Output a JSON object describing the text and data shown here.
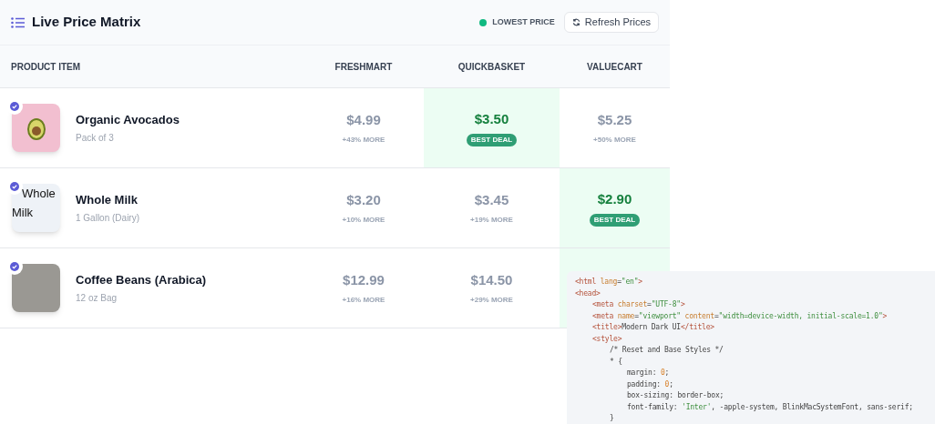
{
  "header": {
    "title": "Live Price Matrix",
    "legend": "LOWEST PRICE",
    "refresh_button": "Refresh Prices"
  },
  "table": {
    "columns": [
      "PRODUCT ITEM",
      "FRESHMART",
      "QUICKBASKET",
      "VALUECART"
    ],
    "rows": [
      {
        "name": "Organic Avocados",
        "detail": "Pack of 3",
        "checked": true,
        "image": {
          "kind": "avocado"
        },
        "prices": [
          {
            "price": "$4.99",
            "note": "+43% MORE",
            "best": false
          },
          {
            "price": "$3.50",
            "badge": "BEST DEAL",
            "best": true
          },
          {
            "price": "$5.25",
            "note": "+50% MORE",
            "best": false
          }
        ]
      },
      {
        "name": "Whole Milk",
        "detail": "1 Gallon (Dairy)",
        "checked": true,
        "image": {
          "kind": "broken",
          "alt": "Whole Milk"
        },
        "prices": [
          {
            "price": "$3.20",
            "note": "+10% MORE",
            "best": false
          },
          {
            "price": "$3.45",
            "note": "+19% MORE",
            "best": false
          },
          {
            "price": "$2.90",
            "badge": "BEST DEAL",
            "best": true
          }
        ]
      },
      {
        "name": "Coffee Beans (Arabica)",
        "detail": "12 oz Bag",
        "checked": true,
        "image": {
          "kind": "photo"
        },
        "prices": [
          {
            "price": "$12.99",
            "note": "+16% MORE",
            "best": false
          },
          {
            "price": "$14.50",
            "note": "+29% MORE",
            "best": false
          },
          {
            "best": true
          }
        ]
      }
    ]
  },
  "code_overlay": {
    "lines": [
      {
        "tokens": [
          {
            "kind": "tag",
            "text": "<html"
          },
          {
            "kind": "attr",
            "text": " lang"
          },
          {
            "kind": "plain",
            "text": "="
          },
          {
            "kind": "string",
            "text": "\"en\""
          },
          {
            "kind": "tag",
            "text": ">"
          }
        ]
      },
      {
        "tokens": [
          {
            "kind": "tag",
            "text": "<head>"
          }
        ],
        "children": [
          {
            "tokens": [
              {
                "kind": "tag",
                "text": "<meta"
              },
              {
                "kind": "attr",
                "text": " charset"
              },
              {
                "kind": "plain",
                "text": "="
              },
              {
                "kind": "string",
                "text": "\"UTF-8\""
              },
              {
                "kind": "tag",
                "text": ">"
              }
            ]
          },
          {
            "tokens": [
              {
                "kind": "tag",
                "text": "<meta"
              },
              {
                "kind": "attr",
                "text": " name"
              },
              {
                "kind": "plain",
                "text": "="
              },
              {
                "kind": "string",
                "text": "\"viewport\""
              },
              {
                "kind": "attr",
                "text": " content"
              },
              {
                "kind": "plain",
                "text": "="
              },
              {
                "kind": "string",
                "text": "\"width=device-width, initial-scale=1.0\""
              },
              {
                "kind": "tag",
                "text": ">"
              }
            ]
          },
          {
            "tokens": [
              {
                "kind": "tag",
                "text": "<title>"
              },
              {
                "kind": "plain",
                "text": "Modern Dark UI"
              },
              {
                "kind": "tag",
                "text": "</title>"
              }
            ]
          },
          {
            "tokens": [
              {
                "kind": "tag",
                "text": "<style>"
              }
            ],
            "children": [
              {
                "tokens": [
                  {
                    "kind": "plain",
                    "text": "/* Reset and Base Styles */"
                  }
                ]
              },
              {
                "tokens": [
                  {
                    "kind": "plain",
                    "text": "* {"
                  }
                ],
                "children": [
                  {
                    "tokens": [
                      {
                        "kind": "plain",
                        "text": "margin: "
                      },
                      {
                        "kind": "number",
                        "text": "0"
                      },
                      {
                        "kind": "plain",
                        "text": ";"
                      }
                    ]
                  },
                  {
                    "tokens": [
                      {
                        "kind": "plain",
                        "text": "padding: "
                      },
                      {
                        "kind": "number",
                        "text": "0"
                      },
                      {
                        "kind": "plain",
                        "text": ";"
                      }
                    ]
                  },
                  {
                    "tokens": [
                      {
                        "kind": "plain",
                        "text": "box-sizing: border-box;"
                      }
                    ]
                  },
                  {
                    "tokens": [
                      {
                        "kind": "plain",
                        "text": "font-family: "
                      },
                      {
                        "kind": "string",
                        "text": "'Inter'"
                      },
                      {
                        "kind": "plain",
                        "text": ", -apple-system, BlinkMacSystemFont, sans-serif;"
                      }
                    ]
                  }
                ]
              },
              {
                "tokens": [
                  {
                    "kind": "plain",
                    "text": "}"
                  }
                ]
              }
            ]
          }
        ]
      }
    ]
  }
}
